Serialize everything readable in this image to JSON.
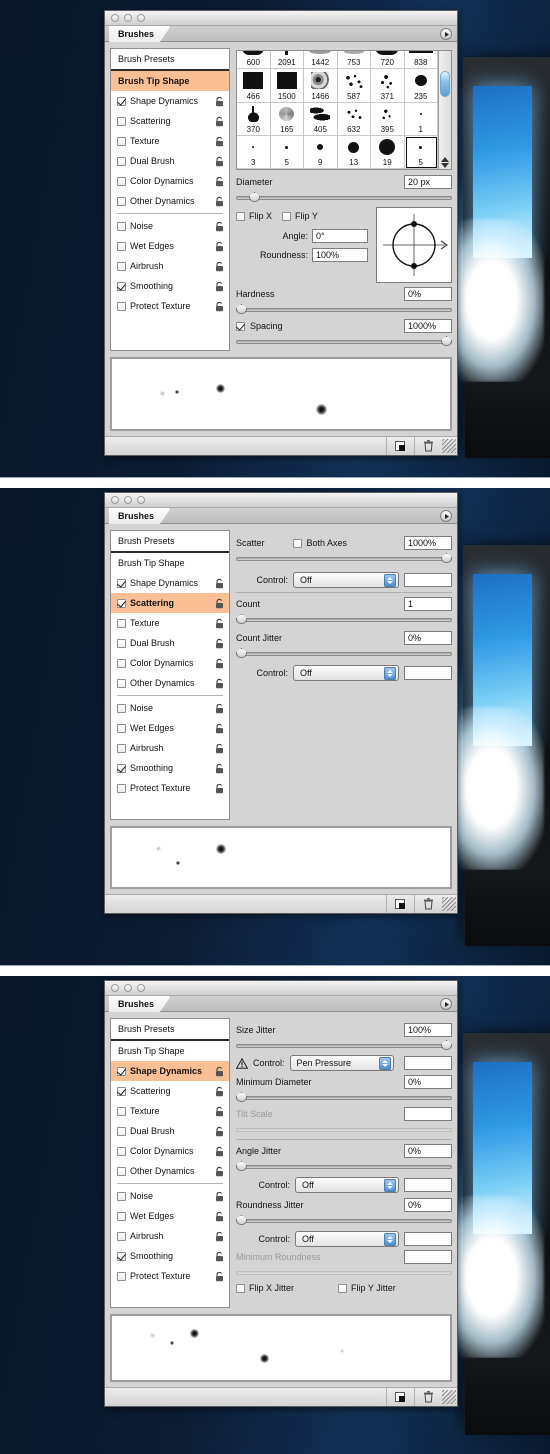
{
  "window": {
    "title": "Brushes",
    "traffic_lights": [
      "close",
      "minimize",
      "zoom"
    ],
    "menu_arrow_icon": "palette-menu-arrow-icon"
  },
  "sidebar": {
    "header": "Brush Presets",
    "items": [
      {
        "label": "Brush Tip Shape",
        "type": "plain",
        "checked": false,
        "lock": false,
        "selected_panel1": true
      },
      {
        "label": "Shape Dynamics",
        "type": "check",
        "checked": true,
        "lock": true
      },
      {
        "label": "Scattering",
        "type": "check",
        "checked": false,
        "lock": true
      },
      {
        "label": "Texture",
        "type": "check",
        "checked": false,
        "lock": true
      },
      {
        "label": "Dual Brush",
        "type": "check",
        "checked": false,
        "lock": true
      },
      {
        "label": "Color Dynamics",
        "type": "check",
        "checked": false,
        "lock": true
      },
      {
        "label": "Other Dynamics",
        "type": "check",
        "checked": false,
        "lock": true
      },
      {
        "label": "Noise",
        "type": "check",
        "checked": false,
        "lock": true
      },
      {
        "label": "Wet Edges",
        "type": "check",
        "checked": false,
        "lock": true
      },
      {
        "label": "Airbrush",
        "type": "check",
        "checked": false,
        "lock": true
      },
      {
        "label": "Smoothing",
        "type": "check",
        "checked": true,
        "lock": true
      },
      {
        "label": "Protect Texture",
        "type": "check",
        "checked": false,
        "lock": true
      }
    ]
  },
  "panel1": {
    "selected_item": "Brush Tip Shape",
    "brush_grid": {
      "rows": [
        [
          {
            "size": "600",
            "shape": "arc"
          },
          {
            "size": "2091",
            "shape": "tick"
          },
          {
            "size": "1442",
            "shape": "smudge"
          },
          {
            "size": "753",
            "shape": "smudge"
          },
          {
            "size": "720",
            "shape": "arc"
          },
          {
            "size": "838",
            "shape": "bar"
          }
        ],
        [
          {
            "size": "466",
            "shape": "square"
          },
          {
            "size": "1500",
            "shape": "square"
          },
          {
            "size": "1466",
            "shape": "texture"
          },
          {
            "size": "587",
            "shape": "spatter"
          },
          {
            "size": "371",
            "shape": "spatter"
          },
          {
            "size": "235",
            "shape": "oval"
          }
        ],
        [
          {
            "size": "370",
            "shape": "drop"
          },
          {
            "size": "165",
            "shape": "swirl"
          },
          {
            "size": "405",
            "shape": "blobs"
          },
          {
            "size": "632",
            "shape": "spatter"
          },
          {
            "size": "395",
            "shape": "spatter"
          },
          {
            "size": "1",
            "shape": "tiny"
          }
        ],
        [
          {
            "size": "3",
            "shape": "round"
          },
          {
            "size": "5",
            "shape": "round"
          },
          {
            "size": "9",
            "shape": "round"
          },
          {
            "size": "13",
            "shape": "round"
          },
          {
            "size": "19",
            "shape": "round"
          },
          {
            "size": "5",
            "shape": "round",
            "selected": true
          }
        ]
      ]
    },
    "diameter": {
      "label": "Diameter",
      "value": "20 px",
      "slider_pct": 6
    },
    "flip_x": {
      "label": "Flip X",
      "checked": false
    },
    "flip_y": {
      "label": "Flip Y",
      "checked": false
    },
    "angle": {
      "label": "Angle:",
      "value": "0°"
    },
    "roundness": {
      "label": "Roundness:",
      "value": "100%"
    },
    "hardness": {
      "label": "Hardness",
      "value": "0%",
      "slider_pct": 0
    },
    "spacing": {
      "label": "Spacing",
      "value": "1000%",
      "checked": true,
      "slider_pct": 100
    }
  },
  "panel2": {
    "selected_item": "Scattering",
    "scatter": {
      "label": "Scatter",
      "value": "1000%",
      "slider_pct": 100
    },
    "both_axes": {
      "label": "Both Axes",
      "checked": false
    },
    "control1": {
      "label": "Control:",
      "value": "Off",
      "field": ""
    },
    "count": {
      "label": "Count",
      "value": "1",
      "slider_pct": 0
    },
    "count_jitter": {
      "label": "Count Jitter",
      "value": "0%",
      "slider_pct": 0
    },
    "control2": {
      "label": "Control:",
      "value": "Off",
      "field": ""
    }
  },
  "panel3": {
    "selected_item": "Shape Dynamics",
    "size_jitter": {
      "label": "Size Jitter",
      "value": "100%",
      "slider_pct": 100
    },
    "control_size": {
      "label": "Control:",
      "value": "Pen Pressure",
      "warning": true,
      "field": ""
    },
    "minimum_diameter": {
      "label": "Minimum Diameter",
      "value": "0%",
      "slider_pct": 0
    },
    "tilt_scale": {
      "label": "Tilt Scale",
      "value": "",
      "disabled": true
    },
    "angle_jitter": {
      "label": "Angle Jitter",
      "value": "0%",
      "slider_pct": 0
    },
    "control_angle": {
      "label": "Control:",
      "value": "Off",
      "field": ""
    },
    "roundness_jitter": {
      "label": "Roundness Jitter",
      "value": "0%",
      "slider_pct": 0
    },
    "control_roundness": {
      "label": "Control:",
      "value": "Off",
      "field": ""
    },
    "minimum_roundness": {
      "label": "Minimum Roundness",
      "value": "",
      "disabled": true
    },
    "flip_x_jitter": {
      "label": "Flip X Jitter",
      "checked": false
    },
    "flip_y_jitter": {
      "label": "Flip Y Jitter",
      "checked": false
    }
  },
  "footer": {
    "new_brush_icon": "new-brush-icon",
    "delete_brush_icon": "trash-icon",
    "resize_grip_icon": "resize-grip-icon"
  },
  "colors": {
    "selection_highlight": "#fbbf95",
    "panel_face": "#d4d4d4",
    "desktop": "#0c1a2d"
  }
}
